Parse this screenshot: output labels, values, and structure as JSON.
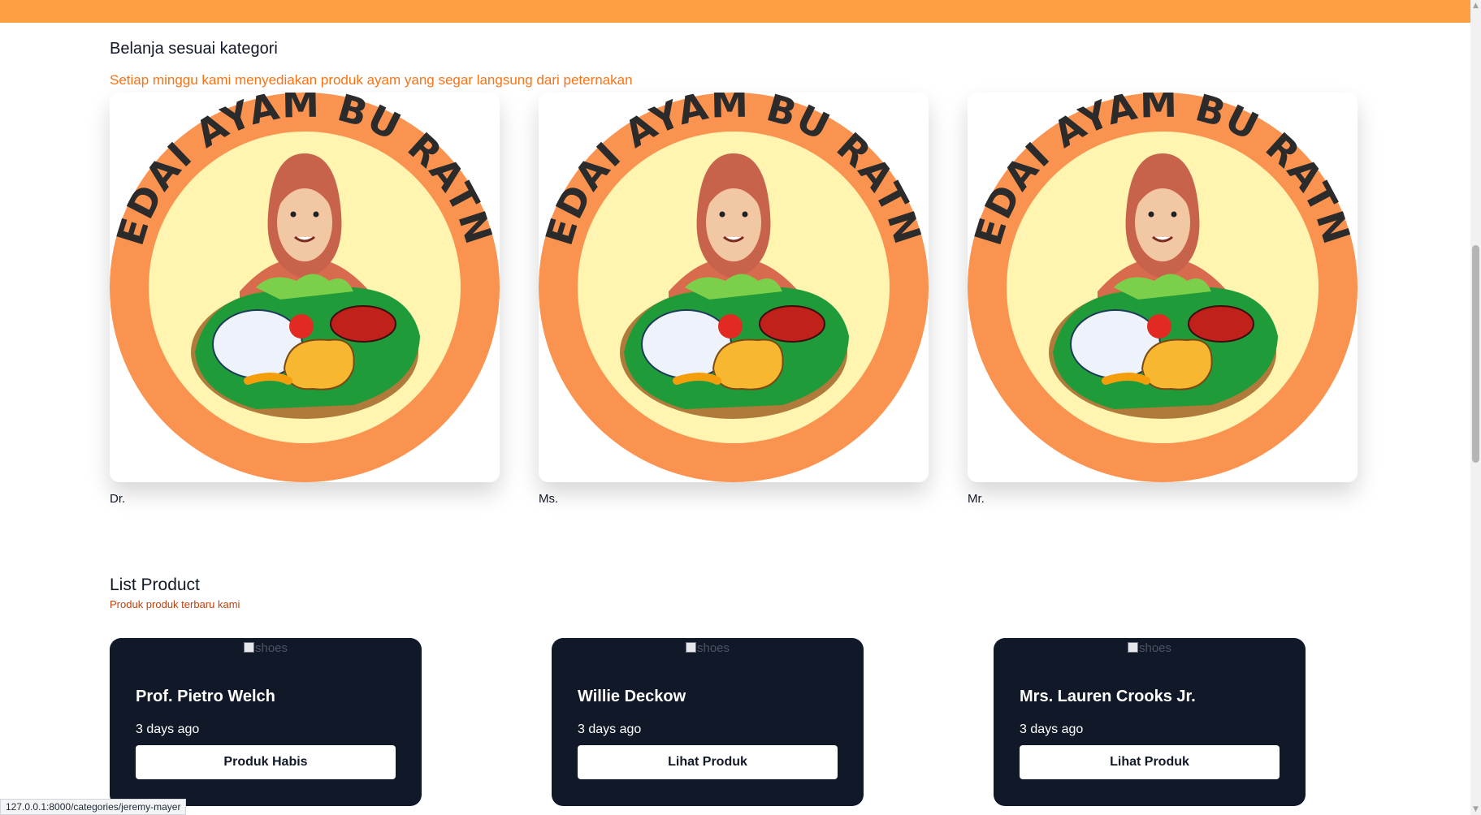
{
  "colors": {
    "topbar": "#ff9f43",
    "accent": "#f97316",
    "card_dark": "#111827"
  },
  "categories_section": {
    "title": "Belanja sesuai kategori",
    "subtitle": "Setiap minggu kami menyediakan produk ayam yang segar langsung dari peternakan",
    "logo_text": "KEDAI AYAM BU RATNA",
    "items": [
      {
        "label": "Dr."
      },
      {
        "label": "Ms."
      },
      {
        "label": "Mr."
      }
    ]
  },
  "products_section": {
    "title": "List Product",
    "subtitle": "Produk produk terbaru kami",
    "items": [
      {
        "image_alt": "shoes",
        "name": "Prof. Pietro Welch",
        "time": "3 days ago",
        "button": "Produk Habis"
      },
      {
        "image_alt": "shoes",
        "name": "Willie Deckow",
        "time": "3 days ago",
        "button": "Lihat Produk"
      },
      {
        "image_alt": "shoes",
        "name": "Mrs. Lauren Crooks Jr.",
        "time": "3 days ago",
        "button": "Lihat Produk"
      }
    ]
  },
  "status_bar": {
    "url": "127.0.0.1:8000/categories/jeremy-mayer"
  }
}
